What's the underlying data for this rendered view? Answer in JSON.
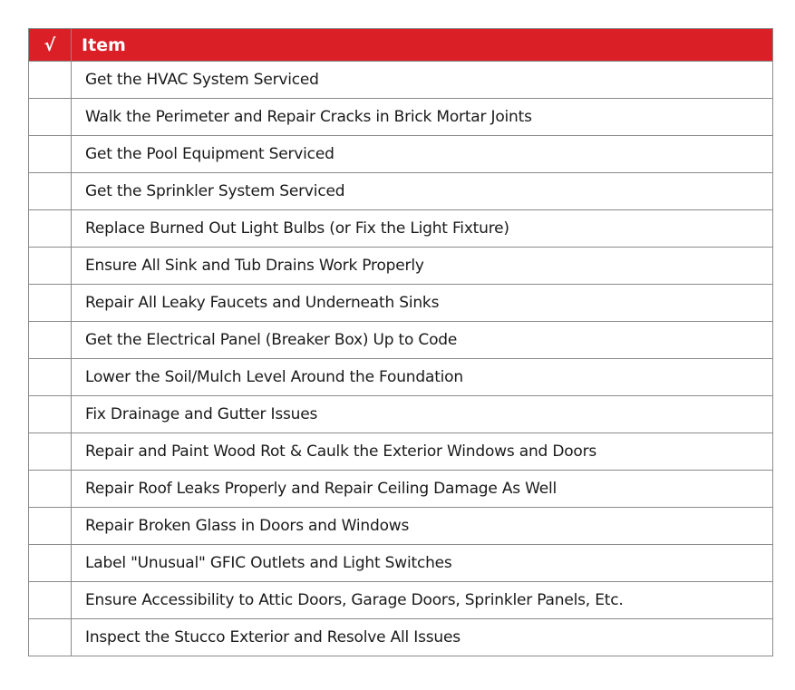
{
  "table": {
    "header": {
      "check": "√",
      "item": "Item"
    },
    "colors": {
      "header_bg": "#da1f27",
      "header_text": "#ffffff",
      "border": "#8a8a8a"
    },
    "rows": [
      "Get the HVAC System Serviced",
      "Walk the Perimeter and Repair Cracks in Brick Mortar Joints",
      "Get the Pool Equipment Serviced",
      "Get the Sprinkler System Serviced",
      "Replace Burned Out Light Bulbs (or Fix the Light Fixture)",
      "Ensure All Sink and Tub Drains Work Properly",
      "Repair All Leaky Faucets and Underneath Sinks",
      "Get the Electrical Panel (Breaker Box) Up to Code",
      "Lower the Soil/Mulch Level Around the Foundation",
      "Fix Drainage and Gutter Issues",
      "Repair and Paint Wood Rot & Caulk the Exterior Windows and Doors",
      "Repair Roof Leaks Properly and Repair Ceiling Damage As Well",
      "Repair Broken Glass in Doors and Windows",
      "Label \"Unusual\" GFIC Outlets and Light Switches",
      "Ensure Accessibility to Attic Doors, Garage Doors, Sprinkler Panels, Etc.",
      "Inspect the Stucco Exterior and Resolve All Issues"
    ]
  }
}
